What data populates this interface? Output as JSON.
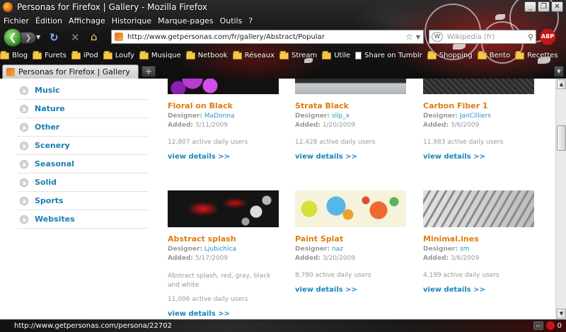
{
  "window": {
    "title": "Personas for Firefox | Gallery - Mozilla Firefox"
  },
  "menu": [
    "Fichier",
    "Édition",
    "Affichage",
    "Historique",
    "Marque-pages",
    "Outils",
    "?"
  ],
  "nav": {
    "url": "http://www.getpersonas.com/fr/gallery/Abstract/Popular",
    "search_placeholder": "Wikipedia (fr)",
    "search_engine_icon": "W",
    "adblock_label": "ABP"
  },
  "bookmarks": [
    {
      "label": "Blog",
      "icon": "folder-icon"
    },
    {
      "label": "Furets",
      "icon": "folder-icon"
    },
    {
      "label": "iPod",
      "icon": "folder-icon"
    },
    {
      "label": "Loufy",
      "icon": "folder-icon"
    },
    {
      "label": "Musique",
      "icon": "folder-icon"
    },
    {
      "label": "Netbook",
      "icon": "folder-icon"
    },
    {
      "label": "Réseaux",
      "icon": "folder-icon"
    },
    {
      "label": "Stream",
      "icon": "folder-icon"
    },
    {
      "label": "Utile",
      "icon": "folder-icon"
    },
    {
      "label": "Share on Tumblr",
      "icon": "page-icon"
    },
    {
      "label": "Shopping",
      "icon": "folder-icon"
    },
    {
      "label": "Bento",
      "icon": "folder-icon"
    },
    {
      "label": "Recettes",
      "icon": "folder-icon"
    }
  ],
  "tab": {
    "title": "Personas for Firefox | Gallery"
  },
  "sidebar": {
    "items": [
      "Music",
      "Nature",
      "Other",
      "Scenery",
      "Seasonal",
      "Solid",
      "Sports",
      "Websites"
    ]
  },
  "labels": {
    "designer": "Designer:",
    "added": "Added:",
    "view_details": "view details >>"
  },
  "personas": [
    {
      "name": "Floral on Black",
      "designer": "MaDonna",
      "added": "3/11/2009",
      "users": "12,807 active daily users",
      "theme": "floral"
    },
    {
      "name": "Strata Black",
      "designer": "slip_x",
      "added": "1/20/2009",
      "users": "12,428 active daily users",
      "theme": "strata"
    },
    {
      "name": "Carbon Fiber 1",
      "designer": "JanCilliers",
      "added": "3/6/2009",
      "users": "11,983 active daily users",
      "theme": "carbon"
    },
    {
      "name": "Abstract splash",
      "designer": "Ljubichica",
      "added": "5/17/2009",
      "description": "Abstract splash, red, gray, black and white",
      "users": "11,006 active daily users",
      "theme": "splash"
    },
    {
      "name": "Paint Splat",
      "designer": "naz",
      "added": "3/20/2009",
      "users": "8,780 active daily users",
      "theme": "paint"
    },
    {
      "name": "Minimal.ines",
      "designer": "sm",
      "added": "3/6/2009",
      "users": "4,199 active daily users",
      "theme": "minimal"
    }
  ],
  "status": {
    "text": "http://www.getpersonas.com/persona/22702",
    "count": "0"
  },
  "colors": {
    "link": "#1a7fb0",
    "title_orange": "#e07b12"
  }
}
